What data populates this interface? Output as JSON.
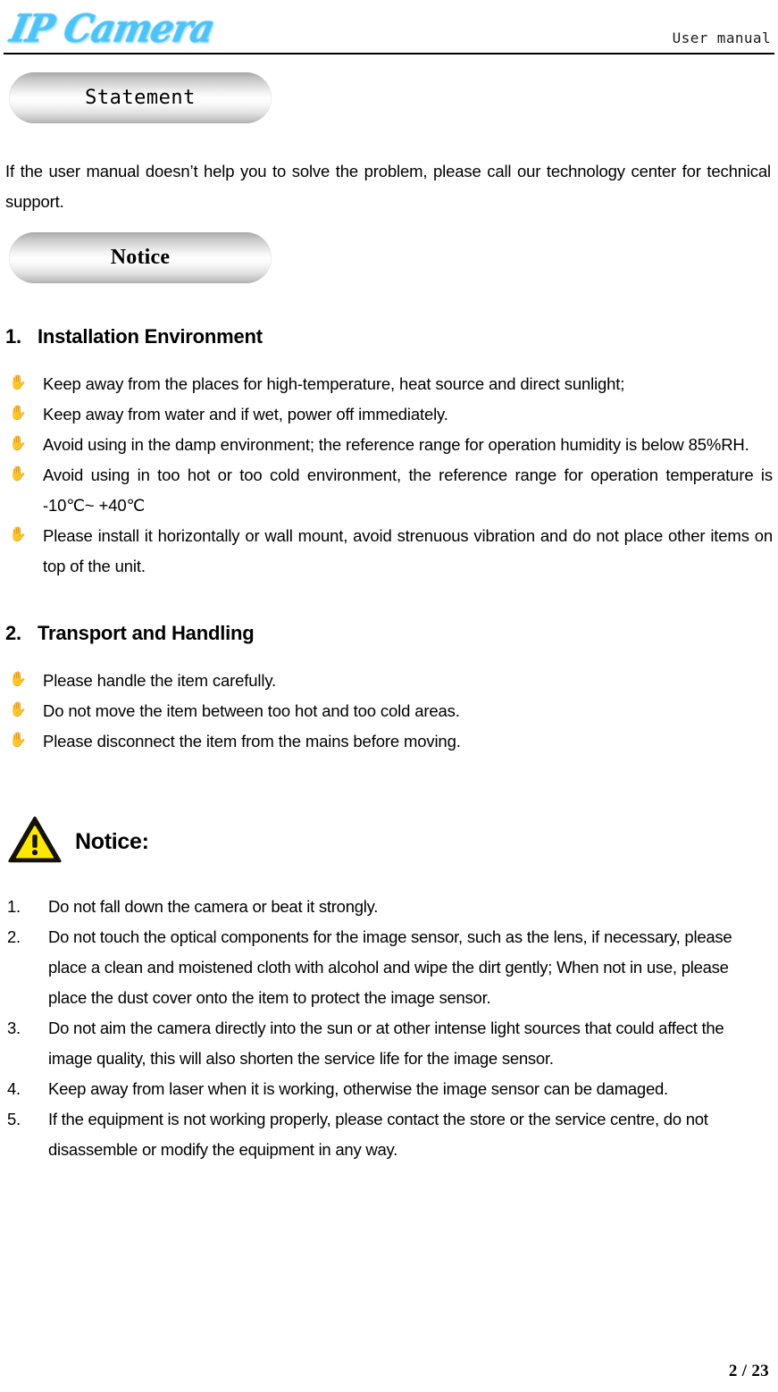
{
  "header": {
    "logo_text": "IP Camera",
    "logo_color": "#4ec3f7",
    "document_type": "User manual"
  },
  "banners": {
    "statement": "Statement",
    "notice": "Notice"
  },
  "intro": {
    "paragraph": "If the user manual doesn’t help you to solve the problem, please call our technology center for technical support."
  },
  "sections": [
    {
      "number": "1.",
      "title": "Installation Environment",
      "bullets": [
        "Keep away from the places for high-temperature, heat source and direct sunlight;",
        "Keep away from water and if wet, power off immediately.",
        "Avoid using in the damp environment; the reference range for operation humidity is below 85%RH.",
        "Avoid using in too hot or too cold environment, the reference range for operation temperature is -10℃~ +40℃",
        "Please install it horizontally or wall mount, avoid strenuous vibration and do not place other items on top of the unit."
      ]
    },
    {
      "number": "2.",
      "title": "Transport and Handling",
      "bullets": [
        "Please handle the item carefully.",
        "Do not move the item between too hot and too cold areas.",
        "Please disconnect the item from the mains before moving."
      ]
    }
  ],
  "warning": {
    "icon": "warning-triangle-icon",
    "triangle_color": "#FFE800",
    "border_color": "#1a1608",
    "label": "Notice:",
    "items": [
      {
        "number": "1.",
        "text": "Do not fall down the camera or beat it strongly."
      },
      {
        "number": "2.",
        "text": "Do not touch the optical components for the image sensor, such as the lens, if necessary, please place a clean and moistened cloth with alcohol and wipe the dirt gently; When not in use, please place the dust cover onto the item to protect the image sensor."
      },
      {
        "number": "3.",
        "text": "Do not aim the camera directly into the sun or at other intense light sources that could affect the image quality, this will also shorten the service life for the image sensor."
      },
      {
        "number": "4.",
        "text": "Keep away from laser when it is working, otherwise the image sensor can be damaged."
      },
      {
        "number": "5.",
        "text": "If the equipment is not working properly, please contact the store or the service centre, do not disassemble or modify the equipment in any way."
      }
    ]
  },
  "footer": {
    "page_indicator": "2 / 23"
  },
  "bullet_glyph": "✋"
}
